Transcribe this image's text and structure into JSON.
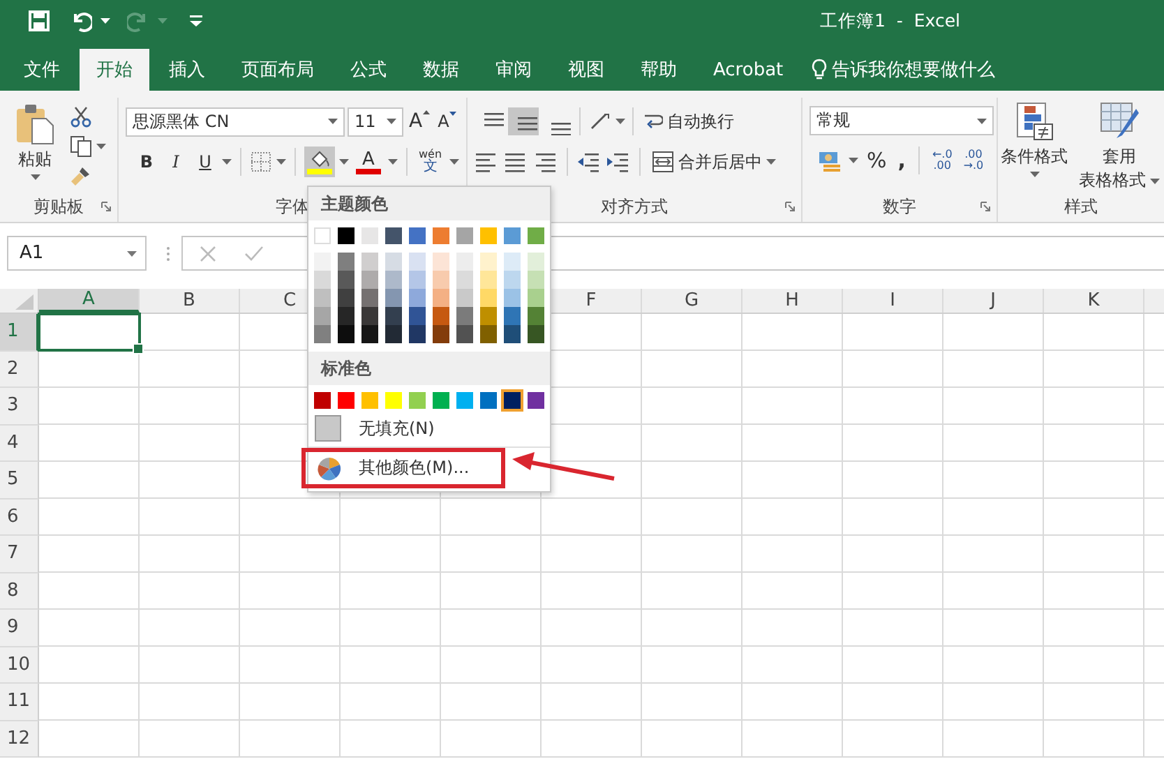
{
  "title_bar": {
    "title": "工作簿1  -  Excel",
    "quick_access": [
      {
        "kind": "save",
        "disabled": false
      },
      {
        "kind": "undo",
        "disabled": false
      },
      {
        "kind": "redo",
        "disabled": true
      },
      {
        "kind": "customize",
        "disabled": false
      }
    ]
  },
  "tabs": [
    {
      "label": "文件",
      "selected": false
    },
    {
      "label": "开始",
      "selected": true
    },
    {
      "label": "插入",
      "selected": false
    },
    {
      "label": "页面布局",
      "selected": false
    },
    {
      "label": "公式",
      "selected": false
    },
    {
      "label": "数据",
      "selected": false
    },
    {
      "label": "审阅",
      "selected": false
    },
    {
      "label": "视图",
      "selected": false
    },
    {
      "label": "帮助",
      "selected": false
    },
    {
      "label": "Acrobat",
      "selected": false
    }
  ],
  "tell_me": {
    "placeholder": "告诉我你想要做什么"
  },
  "ribbon": {
    "clipboard": {
      "paste": "粘贴",
      "group_label": "剪贴板"
    },
    "font": {
      "font_name": "思源黑体 CN",
      "font_size": "11",
      "grow": "A",
      "shrink": "A",
      "bold": "B",
      "italic": "I",
      "underline": "U",
      "fill_bar": {
        "color": "#ffff00"
      },
      "fill_open": true,
      "font_color_letter": "A",
      "font_color_bar": {
        "color": "#e00000"
      },
      "phonetic_top": "wén",
      "phonetic_bottom": "文",
      "group_label": "字体"
    },
    "alignment": {
      "vertical_align": [
        {
          "kind": "top",
          "selected": false
        },
        {
          "kind": "middle",
          "selected": true
        },
        {
          "kind": "bottom",
          "selected": false
        }
      ],
      "wrap_text": "自动换行",
      "merge_center": "合并后居中",
      "group_label": "对齐方式"
    },
    "number": {
      "format": "常规",
      "percent": "%",
      "comma": ",",
      "increase_decimal": [
        "←.0",
        ".00"
      ],
      "decrease_decimal": [
        ".00",
        "→.0"
      ],
      "group_label": "数字"
    },
    "styles": {
      "conditional": "条件格式",
      "table_line1": "套用",
      "table_line2": "表格格式",
      "group_label": "样式"
    }
  },
  "formula_bar": {
    "name_box": "A1"
  },
  "sheet": {
    "columns": [
      {
        "label": "A",
        "selected": true
      },
      {
        "label": "B",
        "selected": false
      },
      {
        "label": "C",
        "selected": false
      },
      {
        "label": "F",
        "selected": false
      },
      {
        "label": "G",
        "selected": false
      },
      {
        "label": "H",
        "selected": false
      },
      {
        "label": "I",
        "selected": false
      },
      {
        "label": "J",
        "selected": false
      },
      {
        "label": "K",
        "selected": false
      }
    ],
    "rows": [
      {
        "label": "1",
        "selected": true
      },
      {
        "label": "2",
        "selected": false
      },
      {
        "label": "3",
        "selected": false
      },
      {
        "label": "4",
        "selected": false
      },
      {
        "label": "5",
        "selected": false
      },
      {
        "label": "6",
        "selected": false
      },
      {
        "label": "7",
        "selected": false
      },
      {
        "label": "8",
        "selected": false
      },
      {
        "label": "9",
        "selected": false
      },
      {
        "label": "10",
        "selected": false
      },
      {
        "label": "11",
        "selected": false
      },
      {
        "label": "12",
        "selected": false
      }
    ]
  },
  "color_menu": {
    "theme_title": "主题颜色",
    "theme_colors": [
      {
        "color": "#ffffff",
        "shades": [
          {
            "color": "#f2f2f2"
          },
          {
            "color": "#d9d9d9"
          },
          {
            "color": "#bfbfbf"
          },
          {
            "color": "#a6a6a6"
          },
          {
            "color": "#808080"
          }
        ]
      },
      {
        "color": "#000000",
        "shades": [
          {
            "color": "#7f7f7f"
          },
          {
            "color": "#595959"
          },
          {
            "color": "#404040"
          },
          {
            "color": "#262626"
          },
          {
            "color": "#0d0d0d"
          }
        ]
      },
      {
        "color": "#e7e6e6",
        "shades": [
          {
            "color": "#d0cece"
          },
          {
            "color": "#aeabab"
          },
          {
            "color": "#757171"
          },
          {
            "color": "#3a3838"
          },
          {
            "color": "#161616"
          }
        ]
      },
      {
        "color": "#44546a",
        "shades": [
          {
            "color": "#d6dce4"
          },
          {
            "color": "#adb9ca"
          },
          {
            "color": "#8496b0"
          },
          {
            "color": "#333f4f"
          },
          {
            "color": "#222a35"
          }
        ]
      },
      {
        "color": "#4472c4",
        "shades": [
          {
            "color": "#d9e1f2"
          },
          {
            "color": "#b4c6e7"
          },
          {
            "color": "#8ea9db"
          },
          {
            "color": "#305496"
          },
          {
            "color": "#203764"
          }
        ]
      },
      {
        "color": "#ed7d31",
        "shades": [
          {
            "color": "#fce4d6"
          },
          {
            "color": "#f8cbad"
          },
          {
            "color": "#f4b084"
          },
          {
            "color": "#c65911"
          },
          {
            "color": "#833c0b"
          }
        ]
      },
      {
        "color": "#a5a5a5",
        "shades": [
          {
            "color": "#ededed"
          },
          {
            "color": "#dbdbdb"
          },
          {
            "color": "#c9c9c9"
          },
          {
            "color": "#7b7b7b"
          },
          {
            "color": "#525252"
          }
        ]
      },
      {
        "color": "#ffc000",
        "shades": [
          {
            "color": "#fff2cc"
          },
          {
            "color": "#ffe699"
          },
          {
            "color": "#ffd966"
          },
          {
            "color": "#bf8f00"
          },
          {
            "color": "#806000"
          }
        ]
      },
      {
        "color": "#5b9bd5",
        "shades": [
          {
            "color": "#ddebf7"
          },
          {
            "color": "#bdd7ee"
          },
          {
            "color": "#9bc2e6"
          },
          {
            "color": "#2f75b5"
          },
          {
            "color": "#1f4e78"
          }
        ]
      },
      {
        "color": "#70ad47",
        "shades": [
          {
            "color": "#e2efda"
          },
          {
            "color": "#c6e0b4"
          },
          {
            "color": "#a9d08e"
          },
          {
            "color": "#548235"
          },
          {
            "color": "#375623"
          }
        ]
      }
    ],
    "standard_title": "标准色",
    "standard_colors": [
      {
        "color": "#c00000",
        "selected": false
      },
      {
        "color": "#ff0000",
        "selected": false
      },
      {
        "color": "#ffc000",
        "selected": false
      },
      {
        "color": "#ffff00",
        "selected": false
      },
      {
        "color": "#92d050",
        "selected": false
      },
      {
        "color": "#00b050",
        "selected": false
      },
      {
        "color": "#00b0f0",
        "selected": false
      },
      {
        "color": "#0070c0",
        "selected": false
      },
      {
        "color": "#002060",
        "selected": true
      },
      {
        "color": "#7030a0",
        "selected": false
      }
    ],
    "no_fill": "无填充(N)",
    "more_colors": {
      "label": "其他颜色(M)...",
      "highlighted": true
    }
  }
}
